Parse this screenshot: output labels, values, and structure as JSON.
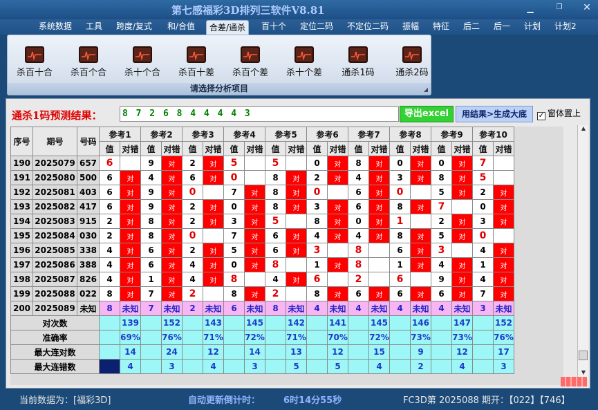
{
  "window": {
    "title": "第七感福彩3D排列三软件V8.81"
  },
  "menu": [
    "系统数据",
    "工具",
    "跨度/复式",
    "和/合值",
    "合差/通杀",
    "百十个",
    "定位二码",
    "不定位二码",
    "振幅",
    "特征",
    "后二",
    "后一",
    "计划",
    "计划2"
  ],
  "ribbon": {
    "items": [
      "杀百十合",
      "杀百个合",
      "杀十个合",
      "杀百十差",
      "杀百个差",
      "杀十个差",
      "通杀1码",
      "通杀2码"
    ],
    "caption": "请选择分析项目"
  },
  "prediction": {
    "label": "通杀1码预测结果：",
    "value": "8 7 2 6 8 4 4 4 4 3",
    "export_btn": "导出excel",
    "gen_btn": "用结果>生成大底",
    "topmost_label": "窗体置上",
    "topmost_checked": true
  },
  "table": {
    "headers": {
      "seq": "序号",
      "period": "期号",
      "number": "号码",
      "refs": [
        "参考1",
        "参考2",
        "参考3",
        "参考4",
        "参考5",
        "参考6",
        "参考7",
        "参考8",
        "参考9",
        "参考10"
      ],
      "val": "值",
      "result": "对错"
    },
    "hit_text": "对",
    "rows": [
      {
        "seq": "190",
        "period": "2025079",
        "number": "657",
        "cells": [
          [
            6,
            0
          ],
          [
            9,
            1
          ],
          [
            2,
            1
          ],
          [
            5,
            0
          ],
          [
            5,
            0
          ],
          [
            0,
            1
          ],
          [
            8,
            1
          ],
          [
            0,
            1
          ],
          [
            0,
            1
          ],
          [
            7,
            0
          ]
        ]
      },
      {
        "seq": "191",
        "period": "2025080",
        "number": "500",
        "cells": [
          [
            6,
            1
          ],
          [
            4,
            1
          ],
          [
            6,
            1
          ],
          [
            0,
            0
          ],
          [
            8,
            1
          ],
          [
            2,
            1
          ],
          [
            4,
            1
          ],
          [
            3,
            1
          ],
          [
            8,
            1
          ],
          [
            5,
            0
          ]
        ]
      },
      {
        "seq": "192",
        "period": "2025081",
        "number": "403",
        "cells": [
          [
            6,
            1
          ],
          [
            9,
            1
          ],
          [
            0,
            0
          ],
          [
            7,
            1
          ],
          [
            8,
            1
          ],
          [
            0,
            0
          ],
          [
            6,
            1
          ],
          [
            0,
            0
          ],
          [
            5,
            1
          ],
          [
            2,
            1
          ]
        ]
      },
      {
        "seq": "193",
        "period": "2025082",
        "number": "417",
        "cells": [
          [
            6,
            1
          ],
          [
            9,
            1
          ],
          [
            2,
            1
          ],
          [
            0,
            1
          ],
          [
            8,
            1
          ],
          [
            3,
            1
          ],
          [
            6,
            1
          ],
          [
            8,
            1
          ],
          [
            7,
            0
          ],
          [
            0,
            1
          ]
        ]
      },
      {
        "seq": "194",
        "period": "2025083",
        "number": "915",
        "cells": [
          [
            2,
            1
          ],
          [
            8,
            1
          ],
          [
            2,
            1
          ],
          [
            3,
            1
          ],
          [
            5,
            0
          ],
          [
            8,
            1
          ],
          [
            0,
            1
          ],
          [
            1,
            0
          ],
          [
            2,
            1
          ],
          [
            3,
            1
          ]
        ]
      },
      {
        "seq": "195",
        "period": "2025084",
        "number": "030",
        "cells": [
          [
            2,
            1
          ],
          [
            8,
            1
          ],
          [
            0,
            0
          ],
          [
            7,
            1
          ],
          [
            6,
            1
          ],
          [
            4,
            1
          ],
          [
            4,
            1
          ],
          [
            8,
            1
          ],
          [
            5,
            1
          ],
          [
            0,
            0
          ]
        ]
      },
      {
        "seq": "196",
        "period": "2025085",
        "number": "338",
        "cells": [
          [
            4,
            1
          ],
          [
            6,
            1
          ],
          [
            2,
            1
          ],
          [
            5,
            1
          ],
          [
            6,
            1
          ],
          [
            3,
            0
          ],
          [
            8,
            0
          ],
          [
            6,
            1
          ],
          [
            3,
            0
          ],
          [
            4,
            1
          ]
        ]
      },
      {
        "seq": "197",
        "period": "2025086",
        "number": "388",
        "cells": [
          [
            4,
            1
          ],
          [
            6,
            1
          ],
          [
            4,
            1
          ],
          [
            0,
            1
          ],
          [
            8,
            0
          ],
          [
            1,
            1
          ],
          [
            8,
            0
          ],
          [
            1,
            1
          ],
          [
            4,
            1
          ],
          [
            1,
            1
          ]
        ]
      },
      {
        "seq": "198",
        "period": "2025087",
        "number": "826",
        "cells": [
          [
            4,
            1
          ],
          [
            1,
            1
          ],
          [
            4,
            1
          ],
          [
            8,
            0
          ],
          [
            4,
            1
          ],
          [
            6,
            0
          ],
          [
            2,
            0
          ],
          [
            6,
            0
          ],
          [
            9,
            1
          ],
          [
            4,
            1
          ]
        ]
      },
      {
        "seq": "199",
        "period": "2025088",
        "number": "022",
        "cells": [
          [
            8,
            1
          ],
          [
            7,
            1
          ],
          [
            2,
            0
          ],
          [
            8,
            1
          ],
          [
            2,
            0
          ],
          [
            8,
            1
          ],
          [
            6,
            1
          ],
          [
            6,
            1
          ],
          [
            6,
            1
          ],
          [
            7,
            1
          ]
        ]
      }
    ],
    "pending_row": {
      "seq": "200",
      "period": "2025089",
      "number": "未知",
      "values": [
        8,
        7,
        2,
        6,
        8,
        4,
        4,
        4,
        4,
        3
      ],
      "status": "未知"
    },
    "stats": [
      {
        "label": "对次数",
        "values": [
          139,
          152,
          143,
          145,
          142,
          141,
          145,
          146,
          147,
          152
        ]
      },
      {
        "label": "准确率",
        "values": [
          "69%",
          "76%",
          "71%",
          "72%",
          "71%",
          "70%",
          "72%",
          "73%",
          "73%",
          "76%"
        ]
      },
      {
        "label": "最大连对数",
        "values": [
          14,
          24,
          12,
          14,
          13,
          12,
          15,
          9,
          12,
          17
        ]
      },
      {
        "label": "最大连错数",
        "values": [
          4,
          3,
          4,
          3,
          5,
          5,
          4,
          2,
          4,
          3
        ]
      }
    ]
  },
  "status": {
    "current_data": "当前数据为：[福彩3D]",
    "countdown_label": "自动更新倒计时：",
    "countdown_value": "6时14分55秒",
    "draw_info": "FC3D第 2025088 期开：【022】【746】"
  },
  "colors": {
    "hit": "#ff0000",
    "stat_bg": "#9df7f7",
    "unknown_bg": "#f7b5f4",
    "title_fg": "#aecbff"
  }
}
